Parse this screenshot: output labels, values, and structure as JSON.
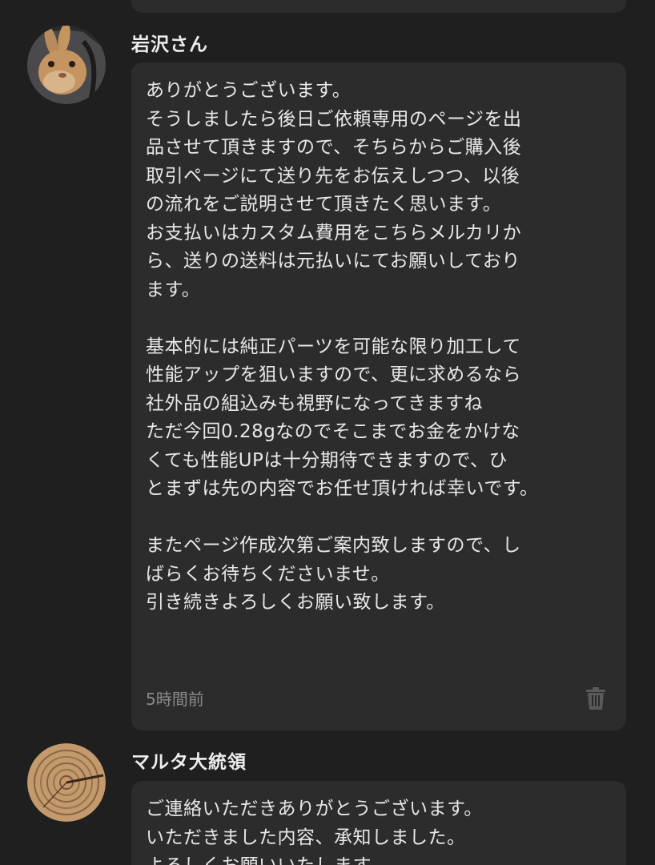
{
  "messages": [
    {
      "sender": "岩沢さん",
      "avatar_icon": "rabbit-avatar-icon",
      "lines": [
        "ありがとうございます。",
        "そうしましたら後日ご依頼専用のページを出",
        "品させて頂きますので、そちらからご購入後",
        "取引ページにて送り先をお伝えしつつ、以後",
        "の流れをご説明させて頂きたく思います。",
        "お支払いはカスタム費用をこちらメルカリか",
        "ら、送りの送料は元払いにてお願いしており",
        "ます。",
        "",
        "基本的には純正パーツを可能な限り加工して",
        "性能アップを狙いますので、更に求めるなら",
        "社外品の組込みも視野になってきますね",
        "ただ今回0.28gなのでそこまでお金をかけな",
        "くても性能UPは十分期待できますので、ひ",
        "とまずは先の内容でお任せ頂ければ幸いです。",
        "",
        "またページ作成次第ご案内致しますので、し",
        "ばらくお待ちくださいませ。",
        "引き続きよろしくお願い致します。"
      ],
      "timestamp": "5時間前",
      "delete_icon": "trash-icon"
    },
    {
      "sender": "マルタ大統領",
      "avatar_icon": "wood-slice-avatar-icon",
      "lines": [
        "ご連絡いただきありがとうございます。",
        "いただきました内容、承知しました。",
        "よろしくお願いいたします。"
      ]
    }
  ],
  "colors": {
    "background": "#1f1f1f",
    "bubble": "#2c2c2c",
    "text": "#e8e8e8",
    "muted": "#8a8a8a"
  }
}
